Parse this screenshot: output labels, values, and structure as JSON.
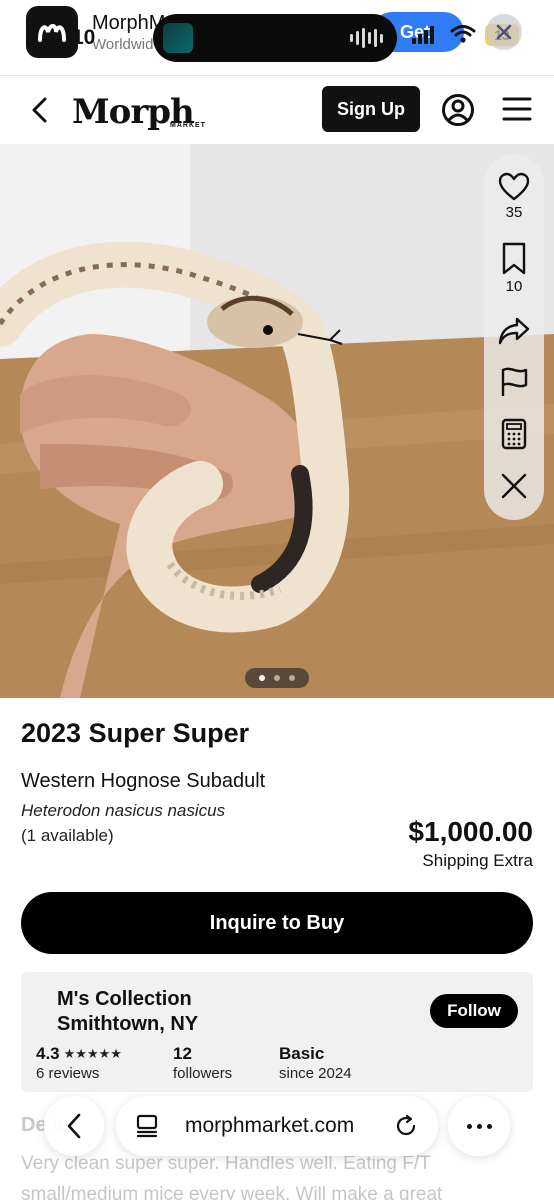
{
  "status": {
    "time": "10",
    "battery": "13"
  },
  "app_banner": {
    "title": "MorphM",
    "subtitle": "Worldwid",
    "get_label": "Get"
  },
  "nav": {
    "logo_text": "Morph",
    "logo_sub": "MARKET",
    "signup_label": "Sign Up"
  },
  "gallery": {
    "active_index": 0,
    "total": 3
  },
  "actions": {
    "likes": "35",
    "saves": "10"
  },
  "listing": {
    "title": "2023 Super Super",
    "subtitle": "Western Hognose Subadult",
    "scientific_name": "Heterodon nasicus nasicus",
    "availability": "(1 available)",
    "price": "$1,000.00",
    "shipping": "Shipping Extra",
    "inquire_label": "Inquire to Buy"
  },
  "seller": {
    "name": "M's Collection",
    "location": "Smithtown, NY",
    "follow_label": "Follow",
    "rating": "4.3",
    "rating_stars": "★★★★★",
    "reviews": "6 reviews",
    "followers_count": "12",
    "followers_label": "followers",
    "plan": "Basic",
    "since": "since 2024"
  },
  "description": {
    "heading": "De        ic",
    "text": "Very clean super super. Handles well. Eating F/T small/medium mice every week. Will make a great"
  },
  "browser": {
    "url": "morphmarket.com"
  }
}
